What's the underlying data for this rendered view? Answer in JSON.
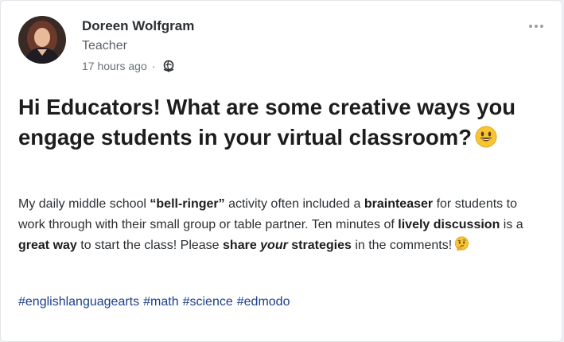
{
  "post": {
    "author": {
      "name": "Doreen Wolfgram",
      "role": "Teacher",
      "avatar_icon": "avatar-photo"
    },
    "timestamp": "17 hours ago",
    "separator": "·",
    "visibility_icon": "globe-icon",
    "menu_icon": "more-options-icon",
    "title": "Hi Educators! What are some creative ways you engage students in your virtual classroom?",
    "title_emoji": "smiling-face-emoji",
    "body": {
      "seg1": "My daily middle school ",
      "seg2": "“bell-ringer”",
      "seg3": " activity often included a ",
      "seg4": "brainteaser",
      "seg5": " for students to work through with their small group or table partner. Ten minutes of ",
      "seg6": "lively discussion",
      "seg7": " is a ",
      "seg8": "great way",
      "seg9": " to start the class! Please ",
      "seg10": "share ",
      "seg11": "your",
      "seg12": " strategies",
      "seg13": " in the comments!",
      "end_emoji": "thinking-face-emoji"
    },
    "hashtags": [
      "#englishlanguagearts",
      "#math",
      "#science",
      "#edmodo"
    ]
  },
  "colors": {
    "hashtag": "#1b3f8b",
    "emoji": "#f7c531"
  }
}
